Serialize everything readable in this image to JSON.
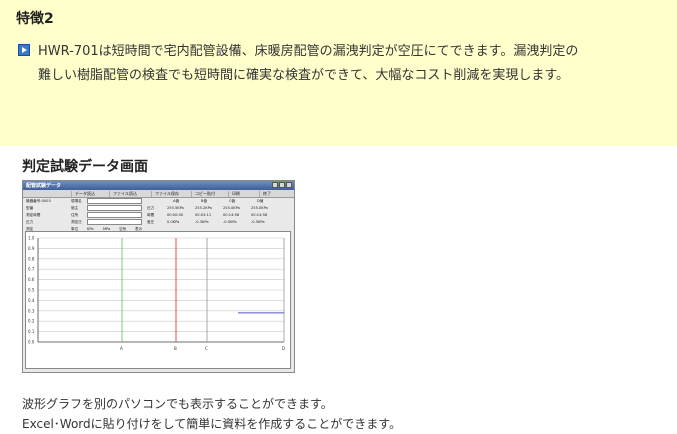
{
  "feature": {
    "title": "特徴2",
    "icon": "play-bullet-icon",
    "text_line1": "HWR-701は短時間で宅内配管設備、床暖房配管の漏洩判定が空圧にてできます。漏洩判定の",
    "text_line2": "難しい樹脂配管の検査でも短時間に確実な検査ができて、大幅なコスト削減を実現します。"
  },
  "section": {
    "title": "判定試験データ画面"
  },
  "window": {
    "title": "配管試験データ",
    "menu": [
      "データ読込",
      "ファイル読込",
      "ファイル保存",
      "コピー貼付",
      "印刷",
      "終了"
    ],
    "info": {
      "row1": [
        "機器番号:0003",
        "現場名",
        "",
        "A値",
        "B値",
        "C値",
        "D値"
      ],
      "row1_input": "",
      "row2": [
        "型番",
        "施主",
        "圧力",
        "255.5KPa",
        "255.2KPa",
        "255.0KPa",
        "255.0KPa"
      ],
      "row2_input": "",
      "row3": [
        "測定時間",
        "住所",
        "時間",
        "00:00:00",
        "00:03:11",
        "00:14:58",
        "00:14:58"
      ],
      "row3_input": "",
      "row4": [
        "圧力",
        "測定日",
        "差圧",
        "0.0KPa",
        "-0.3KPa",
        "-0.5KPa",
        "-0.5KPa"
      ],
      "row4_input": "",
      "row5": [
        "測定",
        "単位",
        "KPa",
        "MPa",
        "空気",
        "表示"
      ]
    },
    "chart": {
      "y_ticks": [
        "1.0",
        "0.9",
        "0.8",
        "0.7",
        "0.6",
        "0.5",
        "0.4",
        "0.3",
        "0.2",
        "0.1",
        "0.0"
      ],
      "x_labels": [
        "A",
        "B",
        "C",
        "D"
      ],
      "colors": {
        "grid": "#c8c8c8",
        "marker_a": "#66cc66",
        "marker_b": "#e83a3a",
        "marker_c": "#a0a0a0",
        "series": "#5050c0"
      }
    }
  },
  "caption": {
    "line1": "波形グラフを別のパソコンでも表示することができます。",
    "line2": "Excel･Wordに貼り付けをして簡単に資料を作成することができます。"
  }
}
